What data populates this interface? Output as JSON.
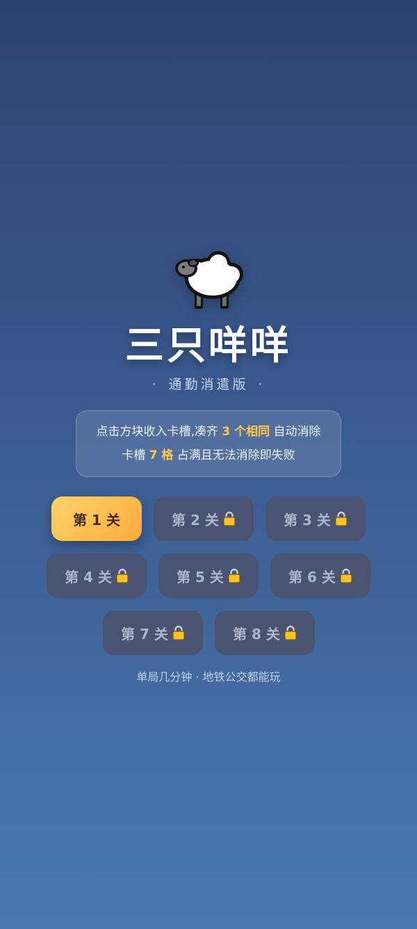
{
  "game": {
    "icon": "sheep-icon",
    "title": "三只咩咩",
    "subtitle": "通勤消遣版",
    "subtitle_dot": "·"
  },
  "rules": {
    "line1_pre": "点击方块收入卡槽,凑齐",
    "line1_hl": "3 个相同",
    "line1_post": "自动消除",
    "line2_pre": "卡槽",
    "line2_hl": "7 格",
    "line2_post": "占满且无法消除即失败"
  },
  "levels": [
    {
      "label": "第 1 关",
      "locked": false
    },
    {
      "label": "第 2 关",
      "locked": true
    },
    {
      "label": "第 3 关",
      "locked": true
    },
    {
      "label": "第 4 关",
      "locked": true
    },
    {
      "label": "第 5 关",
      "locked": true
    },
    {
      "label": "第 6 关",
      "locked": true
    },
    {
      "label": "第 7 关",
      "locked": true
    },
    {
      "label": "第 8 关",
      "locked": true
    }
  ],
  "footer": {
    "text": "单局几分钟 · 地铁公交都能玩"
  },
  "colors": {
    "accent": "#ffc94d",
    "active_button": "#ffbe55",
    "locked_button": "#4b526e",
    "lock_icon": "#f6c22f"
  }
}
